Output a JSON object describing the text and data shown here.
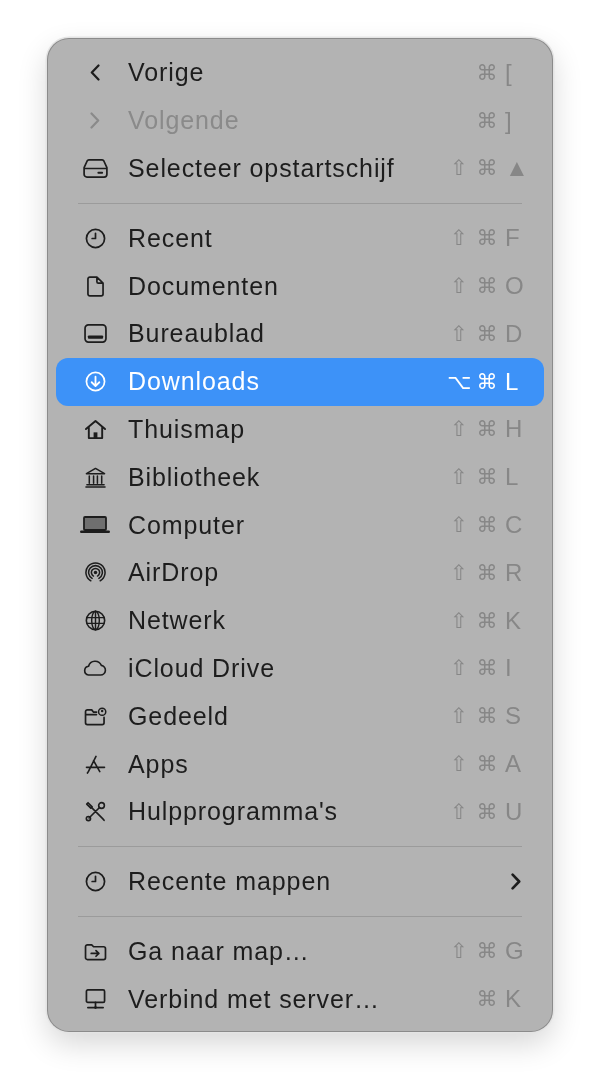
{
  "menu": {
    "sections": [
      {
        "items": [
          {
            "kind": "command",
            "label": "Vorige",
            "shortcut": [
              "⌘",
              "["
            ],
            "disabled": false,
            "selected": false
          },
          {
            "kind": "command",
            "label": "Volgende",
            "shortcut": [
              "⌘",
              "]"
            ],
            "disabled": true,
            "selected": false
          },
          {
            "kind": "command",
            "label": "Selecteer opstartschijf",
            "shortcut": [
              "⇧",
              "⌘",
              "▲"
            ],
            "disabled": false,
            "selected": false
          }
        ]
      },
      {
        "items": [
          {
            "kind": "command",
            "label": "Recent",
            "shortcut": [
              "⇧",
              "⌘",
              "F"
            ],
            "disabled": false,
            "selected": false
          },
          {
            "kind": "command",
            "label": "Documenten",
            "shortcut": [
              "⇧",
              "⌘",
              "O"
            ],
            "disabled": false,
            "selected": false
          },
          {
            "kind": "command",
            "label": "Bureaublad",
            "shortcut": [
              "⇧",
              "⌘",
              "D"
            ],
            "disabled": false,
            "selected": false
          },
          {
            "kind": "command",
            "label": "Downloads",
            "shortcut": [
              "⌥",
              "⌘",
              "L"
            ],
            "disabled": false,
            "selected": true
          },
          {
            "kind": "command",
            "label": "Thuismap",
            "shortcut": [
              "⇧",
              "⌘",
              "H"
            ],
            "disabled": false,
            "selected": false
          },
          {
            "kind": "command",
            "label": "Bibliotheek",
            "shortcut": [
              "⇧",
              "⌘",
              "L"
            ],
            "disabled": false,
            "selected": false
          },
          {
            "kind": "command",
            "label": "Computer",
            "shortcut": [
              "⇧",
              "⌘",
              "C"
            ],
            "disabled": false,
            "selected": false
          },
          {
            "kind": "command",
            "label": "AirDrop",
            "shortcut": [
              "⇧",
              "⌘",
              "R"
            ],
            "disabled": false,
            "selected": false
          },
          {
            "kind": "command",
            "label": "Netwerk",
            "shortcut": [
              "⇧",
              "⌘",
              "K"
            ],
            "disabled": false,
            "selected": false
          },
          {
            "kind": "command",
            "label": "iCloud Drive",
            "shortcut": [
              "⇧",
              "⌘",
              "I"
            ],
            "disabled": false,
            "selected": false
          },
          {
            "kind": "command",
            "label": "Gedeeld",
            "shortcut": [
              "⇧",
              "⌘",
              "S"
            ],
            "disabled": false,
            "selected": false
          },
          {
            "kind": "command",
            "label": "Apps",
            "shortcut": [
              "⇧",
              "⌘",
              "A"
            ],
            "disabled": false,
            "selected": false
          },
          {
            "kind": "command",
            "label": "Hulpprogramma's",
            "shortcut": [
              "⇧",
              "⌘",
              "U"
            ],
            "disabled": false,
            "selected": false
          }
        ]
      },
      {
        "items": [
          {
            "kind": "submenu",
            "label": "Recente mappen",
            "disabled": false,
            "selected": false
          }
        ]
      },
      {
        "items": [
          {
            "kind": "command",
            "label": "Ga naar map…",
            "shortcut": [
              "⇧",
              "⌘",
              "G"
            ],
            "disabled": false,
            "selected": false
          },
          {
            "kind": "command",
            "label": "Verbind met server…",
            "shortcut": [
              "⌘",
              "K"
            ],
            "disabled": false,
            "selected": false
          }
        ]
      }
    ]
  }
}
